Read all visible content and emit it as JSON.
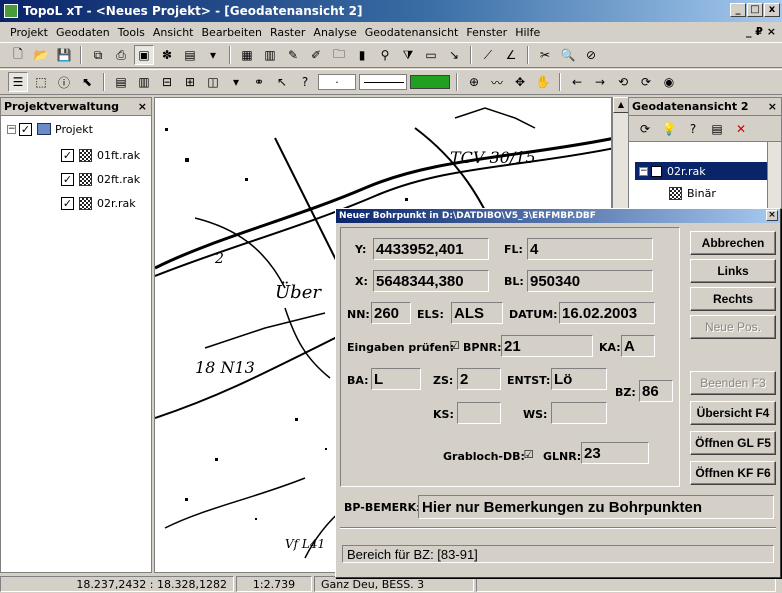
{
  "window": {
    "title": "TopoL xT - <Neues Projekt> - [Geodatenansicht 2]",
    "btn_min": "_",
    "btn_max": "□",
    "btn_close": "x"
  },
  "menu": {
    "items": [
      "Projekt",
      "Geodaten",
      "Tools",
      "Ansicht",
      "Bearbeiten",
      "Raster",
      "Analyse",
      "Geodatenansicht",
      "Fenster",
      "Hilfe"
    ],
    "right": "_ ₽ ×"
  },
  "left_panel": {
    "title": "Projektverwaltung",
    "close": "×",
    "root": "Projekt",
    "items": [
      "01ft.rak",
      "02ft.rak",
      "02r.rak"
    ]
  },
  "right_panel": {
    "title": "Geodatenansicht 2",
    "close": "×",
    "layer": "02r.rak",
    "sublayer": "Binär"
  },
  "status": {
    "coords": "18.237,2432 : 18.328,1282",
    "scale": "1:2.739",
    "info": "Ganz Deu, BESS. 3"
  },
  "dialog": {
    "title": "Neuer Bohrpunkt in D:\\DATDIBO\\V5_3\\ERFMBP.DBF",
    "close": "×",
    "labels": {
      "y": "Y:",
      "x": "X:",
      "fl": "FL:",
      "bl": "BL:",
      "nn": "NN:",
      "els": "ELS:",
      "datum": "DATUM:",
      "eingaben": "Eingaben prüfen:",
      "bpnr": "BPNR:",
      "ka": "KA:",
      "ba": "BA:",
      "zs": "ZS:",
      "entst": "ENTST:",
      "bz": "BZ:",
      "ks": "KS:",
      "ws": "WS:",
      "grabloch": "Grabloch-DB:",
      "glnr": "GLNR:",
      "bp_bemerk": "BP-BEMERK:"
    },
    "values": {
      "y": "4433952,401",
      "x": "5648344,380",
      "fl": "4",
      "bl": "950340",
      "nn": "260",
      "els": "ALS",
      "datum": "16.02.2003",
      "bpnr": "21",
      "ka": "A",
      "ba": "L",
      "zs": "2",
      "entst": "Lö",
      "bz": "86",
      "ks": "",
      "ws": "",
      "glnr": "23",
      "bp_bemerk": "Hier nur Bemerkungen zu Bohrpunkten"
    },
    "checks": {
      "eingaben": "☑",
      "grabloch": "☑"
    },
    "buttons": {
      "abbrechen": "Abbrechen",
      "links": "Links",
      "rechts": "Rechts",
      "neue_pos": "Neue Pos.",
      "beenden": "Beenden F3",
      "uebersicht": "Übersicht F4",
      "oeffnen_gl": "Öffnen GL F5",
      "oeffnen_kf": "Öffnen KF F6"
    },
    "status": "Bereich für BZ: [83-91]"
  }
}
